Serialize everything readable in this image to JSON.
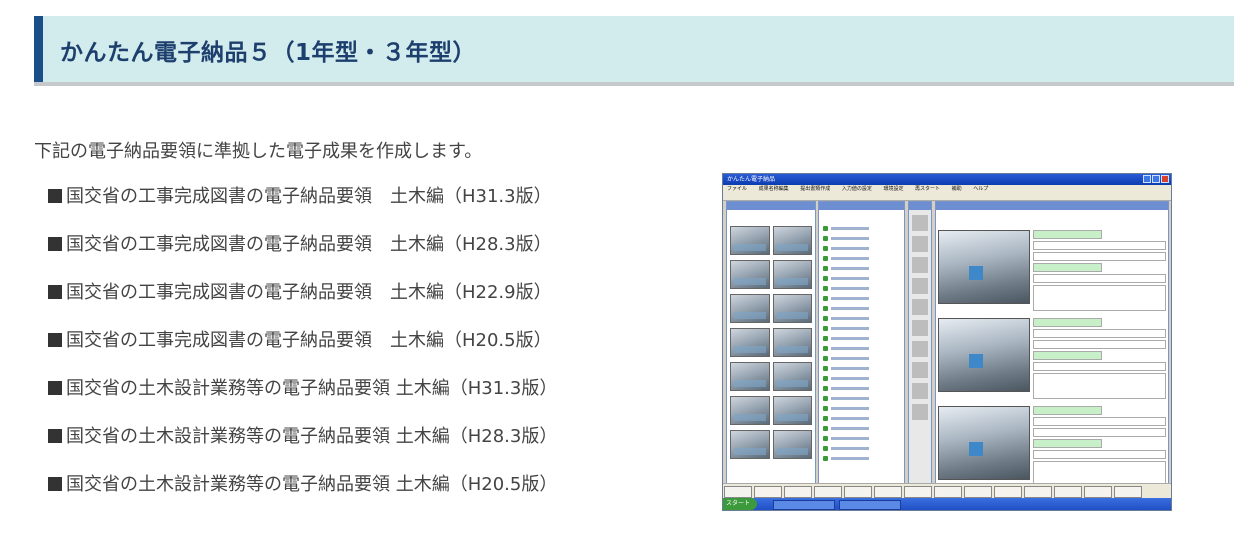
{
  "header": {
    "title": "かんたん電子納品５（1年型・３年型）"
  },
  "intro": "下記の電子納品要領に準拠した電子成果を作成します。",
  "requirements": [
    "国交省の工事完成図書の電子納品要領　土木編（H31.3版）",
    "国交省の工事完成図書の電子納品要領　土木編（H28.3版）",
    "国交省の工事完成図書の電子納品要領　土木編（H22.9版）",
    "国交省の工事完成図書の電子納品要領　土木編（H20.5版）",
    "国交省の土木設計業務等の電子納品要領 土木編（H31.3版）",
    "国交省の土木設計業務等の電子納品要領 土木編（H28.3版）",
    "国交省の土木設計業務等の電子納品要領 土木編（H20.5版）"
  ],
  "screenshot": {
    "window_title": "かんたん電子納品",
    "menu": [
      "ファイル",
      "成果名称編集",
      "提出書類作成",
      "入力値の設定",
      "環境設定",
      "再スタート",
      "補助",
      "ヘルプ"
    ],
    "start_label": "スタート"
  },
  "colors": {
    "header_bg": "#d2ebec",
    "header_bar": "#1b4f8a",
    "title_text": "#1c3f6e"
  }
}
